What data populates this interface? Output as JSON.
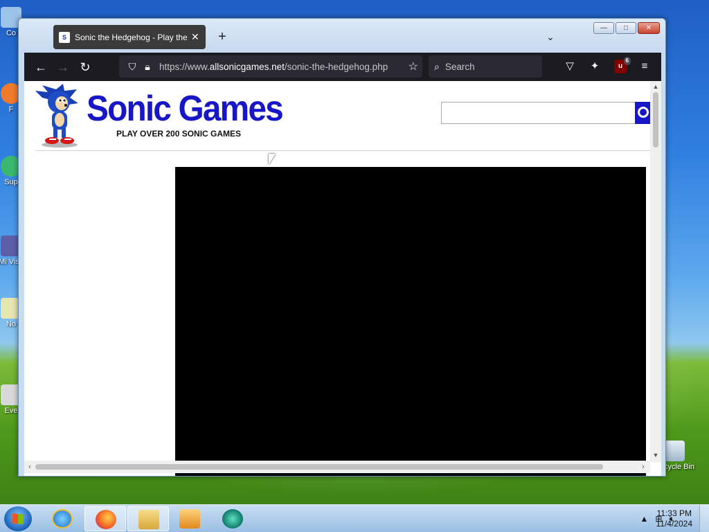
{
  "desktop": {
    "icons": [
      {
        "label": "Co"
      },
      {
        "label": "F"
      },
      {
        "label": "Sup"
      },
      {
        "label": "Mi Visu"
      },
      {
        "label": "No"
      },
      {
        "label": "Eve"
      },
      {
        "label": "Recycle Bin"
      }
    ]
  },
  "browser": {
    "tab": {
      "title": "Sonic the Hedgehog - Play the",
      "favicon": "sonic-favicon",
      "close": "✕"
    },
    "new_tab": "+",
    "tab_list": "⌄",
    "window_buttons": {
      "minimize": "—",
      "maximize": "□",
      "close": "✕"
    },
    "nav": {
      "back": "←",
      "forward": "→",
      "reload": "↻"
    },
    "url": {
      "prefix": "https://www.",
      "domain": "allsonicgames.net",
      "path": "/sonic-the-hedgehog.php"
    },
    "search_placeholder": "Search",
    "ublock_count": "6",
    "menu": "≡"
  },
  "page": {
    "title": "Sonic Games",
    "tagline": "PLAY OVER 200 SONIC GAMES",
    "search_value": ""
  },
  "taskbar": {
    "clock_time": "11:33 PM",
    "clock_date": "11/4/2024"
  },
  "colors": {
    "brand_blue": "#1717c7",
    "browser_dark": "#1c1b22"
  }
}
